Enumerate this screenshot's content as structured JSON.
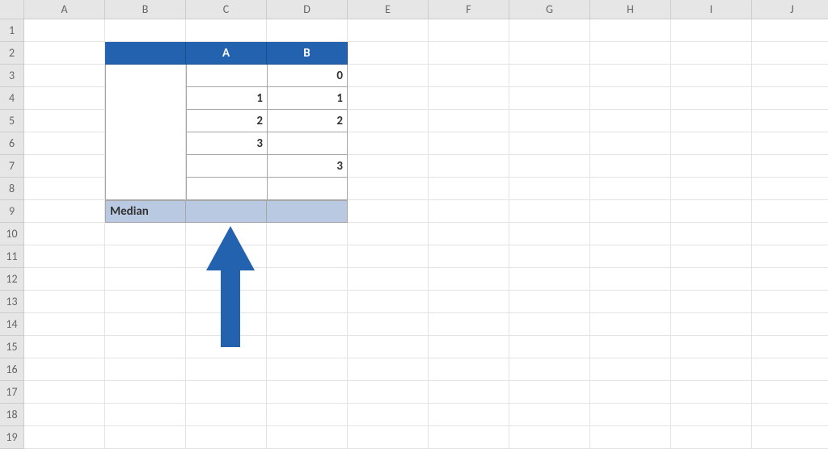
{
  "columns": [
    "A",
    "B",
    "C",
    "D",
    "E",
    "F",
    "G",
    "H",
    "I",
    "J"
  ],
  "rows": [
    "1",
    "2",
    "3",
    "4",
    "5",
    "6",
    "7",
    "8",
    "9",
    "10",
    "11",
    "12",
    "13",
    "14",
    "15",
    "16",
    "17",
    "18",
    "19"
  ],
  "table": {
    "header_blank": "",
    "header_a": "A",
    "header_b": "B",
    "r3": {
      "b": "",
      "c": "",
      "d": "0"
    },
    "r4": {
      "b": "",
      "c": "1",
      "d": "1"
    },
    "r5": {
      "b": "",
      "c": "2",
      "d": "2"
    },
    "r6": {
      "b": "",
      "c": "3",
      "d": ""
    },
    "r7": {
      "b": "",
      "c": "",
      "d": "3"
    },
    "r8": {
      "b": "",
      "c": "",
      "d": ""
    },
    "median_label": "Median",
    "median_c": "",
    "median_d": ""
  },
  "arrow_color": "#2262ae",
  "chart_data": {
    "type": "table",
    "title": "",
    "columns": [
      "A",
      "B"
    ],
    "rows": [
      [
        null,
        0
      ],
      [
        1,
        1
      ],
      [
        2,
        2
      ],
      [
        3,
        null
      ],
      [
        null,
        3
      ],
      [
        null,
        null
      ]
    ],
    "summary_label": "Median",
    "summary_values": [
      null,
      null
    ]
  }
}
